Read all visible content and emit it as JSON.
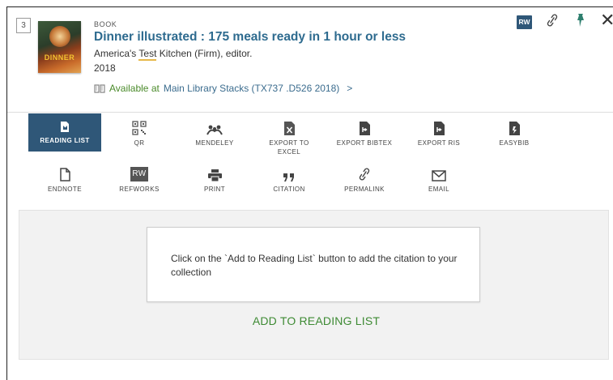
{
  "record": {
    "index": "3",
    "type": "BOOK",
    "title": "Dinner illustrated : 175 meals ready in 1 hour or less",
    "author_pre": "America's ",
    "author_hl": "Test",
    "author_post": " Kitchen (Firm), editor.",
    "year": "2018",
    "cover_text": "DINNER",
    "availability": {
      "status": "Available at",
      "location": "Main Library  Stacks (TX737 .D526 2018)",
      "chevron": ">"
    }
  },
  "top_actions": {
    "refworks_badge": "RW",
    "close": "✕"
  },
  "tools_row1": [
    {
      "label": "READING LIST",
      "icon": "reading-list-icon"
    },
    {
      "label": "QR",
      "icon": "qr-code-icon"
    },
    {
      "label": "MENDELEY",
      "icon": "mendeley-icon"
    },
    {
      "label": "EXPORT TO\nEXCEL",
      "icon": "excel-icon"
    },
    {
      "label": "EXPORT BIBTEX",
      "icon": "bibtex-icon"
    },
    {
      "label": "EXPORT RIS",
      "icon": "ris-icon"
    },
    {
      "label": "EASYBIB",
      "icon": "easybib-icon"
    }
  ],
  "tools_row2": [
    {
      "label": "ENDNOTE",
      "icon": "endnote-icon"
    },
    {
      "label": "REFWORKS",
      "icon": "refworks-icon"
    },
    {
      "label": "PRINT",
      "icon": "print-icon"
    },
    {
      "label": "CITATION",
      "icon": "citation-icon"
    },
    {
      "label": "PERMALINK",
      "icon": "permalink-icon"
    },
    {
      "label": "EMAIL",
      "icon": "email-icon"
    }
  ],
  "panel": {
    "message": "Click on the `Add to Reading List` button to add the citation to your collection",
    "button": "ADD TO READING LIST"
  },
  "colors": {
    "accent": "#2f5778",
    "title": "#2e6b8f",
    "available": "#4a8a2a",
    "add_button": "#3d8a33"
  }
}
